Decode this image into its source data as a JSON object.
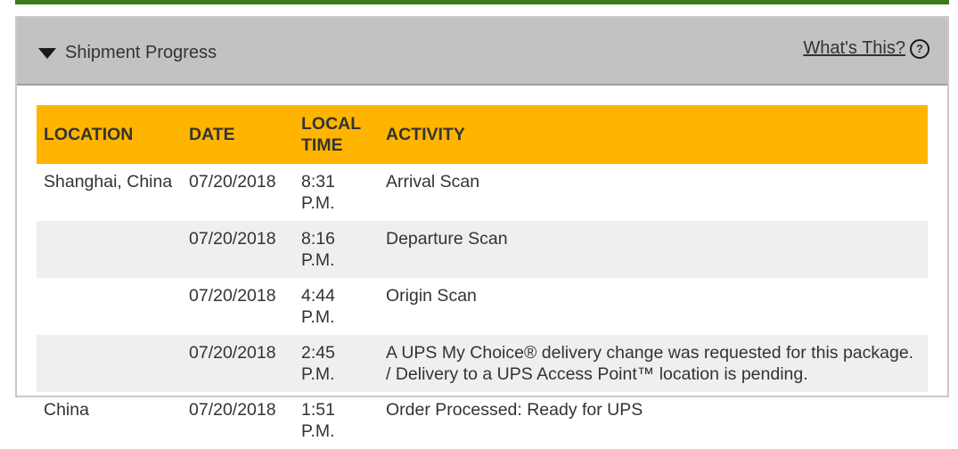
{
  "header": {
    "section_title": "Shipment Progress",
    "help_link": "What's This?"
  },
  "table": {
    "columns": [
      "LOCATION",
      "DATE",
      "LOCAL TIME",
      "ACTIVITY"
    ],
    "rows": [
      {
        "location": "Shanghai,  China",
        "date": "07/20/2018",
        "time": "8:31 P.M.",
        "activity": "Arrival Scan"
      },
      {
        "location": "",
        "date": "07/20/2018",
        "time": "8:16 P.M.",
        "activity": "Departure Scan"
      },
      {
        "location": "",
        "date": "07/20/2018",
        "time": "4:44 P.M.",
        "activity": "Origin Scan"
      },
      {
        "location": "",
        "date": "07/20/2018",
        "time": "2:45 P.M.",
        "activity": "A UPS My Choice® delivery change was requested for this package. / Delivery to a UPS Access Point™ location is pending."
      },
      {
        "location": "China",
        "date": "07/20/2018",
        "time": "1:51 P.M.",
        "activity": "Order Processed: Ready for UPS"
      }
    ]
  },
  "colors": {
    "header_accent": "#ffb500",
    "top_bar": "#3c7a1c",
    "panel_header": "#c2c2c2"
  },
  "icons": [
    "caret-down-icon",
    "help-circle-icon"
  ]
}
